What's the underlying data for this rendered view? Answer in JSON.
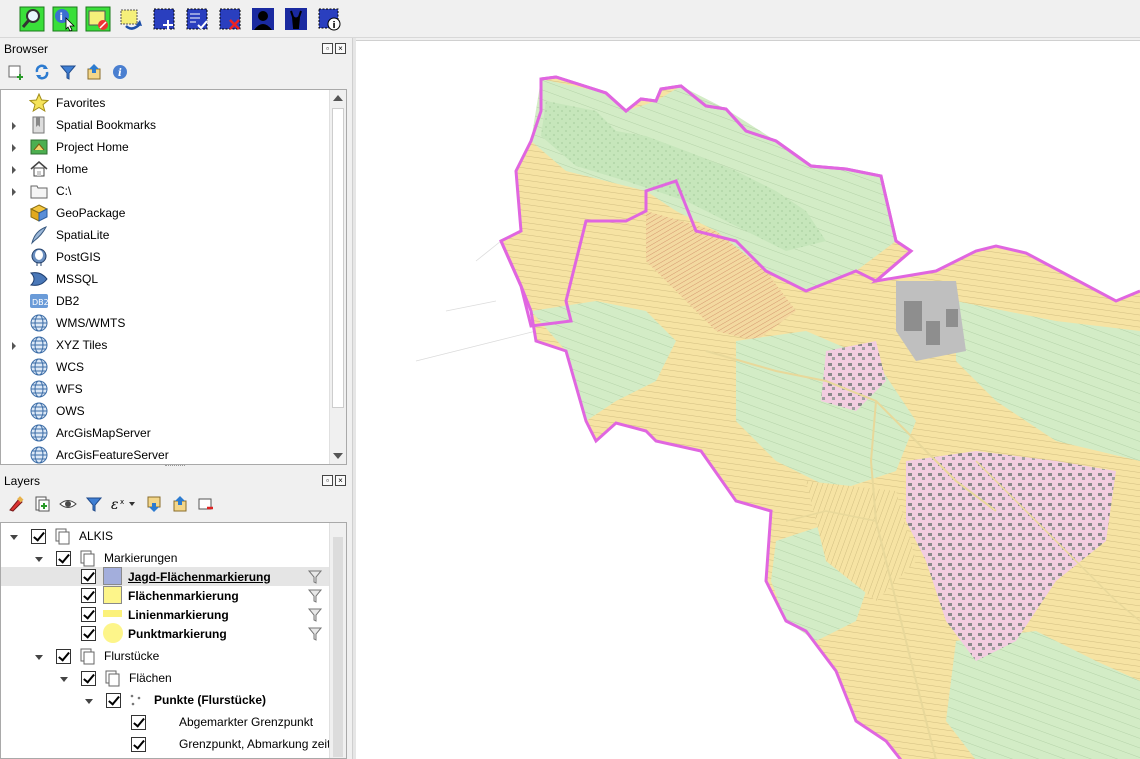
{
  "toolbar": {
    "buttons": [
      "zoom-to-selection-icon",
      "identify-features-icon",
      "deselect-features-icon",
      "switch-selection-icon",
      "add-to-selection-icon",
      "select-by-list-icon",
      "remove-selection-icon",
      "user-icon",
      "hunting-icon",
      "area-info-icon"
    ]
  },
  "browser": {
    "title": "Browser",
    "items": [
      {
        "label": "Favorites",
        "expandable": false,
        "icon": "star-icon"
      },
      {
        "label": "Spatial Bookmarks",
        "expandable": true,
        "icon": "bookmark-icon"
      },
      {
        "label": "Project Home",
        "expandable": true,
        "icon": "project-home-icon"
      },
      {
        "label": "Home",
        "expandable": true,
        "icon": "home-icon"
      },
      {
        "label": "C:\\",
        "expandable": true,
        "icon": "folder-icon"
      },
      {
        "label": "GeoPackage",
        "expandable": false,
        "icon": "geopackage-icon"
      },
      {
        "label": "SpatiaLite",
        "expandable": false,
        "icon": "spatialite-icon"
      },
      {
        "label": "PostGIS",
        "expandable": false,
        "icon": "postgis-icon"
      },
      {
        "label": "MSSQL",
        "expandable": false,
        "icon": "mssql-icon"
      },
      {
        "label": "DB2",
        "expandable": false,
        "icon": "db2-icon"
      },
      {
        "label": "WMS/WMTS",
        "expandable": false,
        "icon": "globe-icon"
      },
      {
        "label": "XYZ Tiles",
        "expandable": true,
        "icon": "globe-icon"
      },
      {
        "label": "WCS",
        "expandable": false,
        "icon": "globe-icon"
      },
      {
        "label": "WFS",
        "expandable": false,
        "icon": "globe-icon"
      },
      {
        "label": "OWS",
        "expandable": false,
        "icon": "globe-icon"
      },
      {
        "label": "ArcGisMapServer",
        "expandable": false,
        "icon": "globe-icon"
      },
      {
        "label": "ArcGisFeatureServer",
        "expandable": false,
        "icon": "globe-icon"
      }
    ],
    "db2_badge": "DB2"
  },
  "layers": {
    "title": "Layers",
    "rows": [
      {
        "label": "ALKIS",
        "bold": false,
        "underline": false
      },
      {
        "label": "Markierungen",
        "bold": false,
        "underline": false
      },
      {
        "label": "Jagd-Flächenmarkierung",
        "bold": true,
        "underline": true,
        "swatch": "#a3aedc"
      },
      {
        "label": "Flächenmarkierung",
        "bold": true,
        "underline": false,
        "swatch": "#fdf58a"
      },
      {
        "label": "Linienmarkierung",
        "bold": true,
        "underline": false,
        "swatch": "#fbf17a"
      },
      {
        "label": "Punktmarkierung",
        "bold": true,
        "underline": false,
        "swatch": "#fdf58a"
      },
      {
        "label": "Flurstücke",
        "bold": false,
        "underline": false
      },
      {
        "label": "Flächen",
        "bold": false,
        "underline": false
      },
      {
        "label": "Punkte (Flurstücke)",
        "bold": true,
        "underline": false
      },
      {
        "label": "Abgemarkter Grenzpunkt",
        "bold": false,
        "underline": false
      },
      {
        "label": "Grenzpunkt, Abmarkung zeit",
        "bold": false,
        "underline": false
      }
    ]
  },
  "colors": {
    "boundary": "#e066e0",
    "field_yellow": "#f7e6a0",
    "meadow_green": "#cde8c2",
    "forest_green": "#b8e0b0",
    "settlement_pink": "#f0c8d8",
    "building_gray": "#9a9a9a",
    "selected_row": "#e5e5e5"
  }
}
